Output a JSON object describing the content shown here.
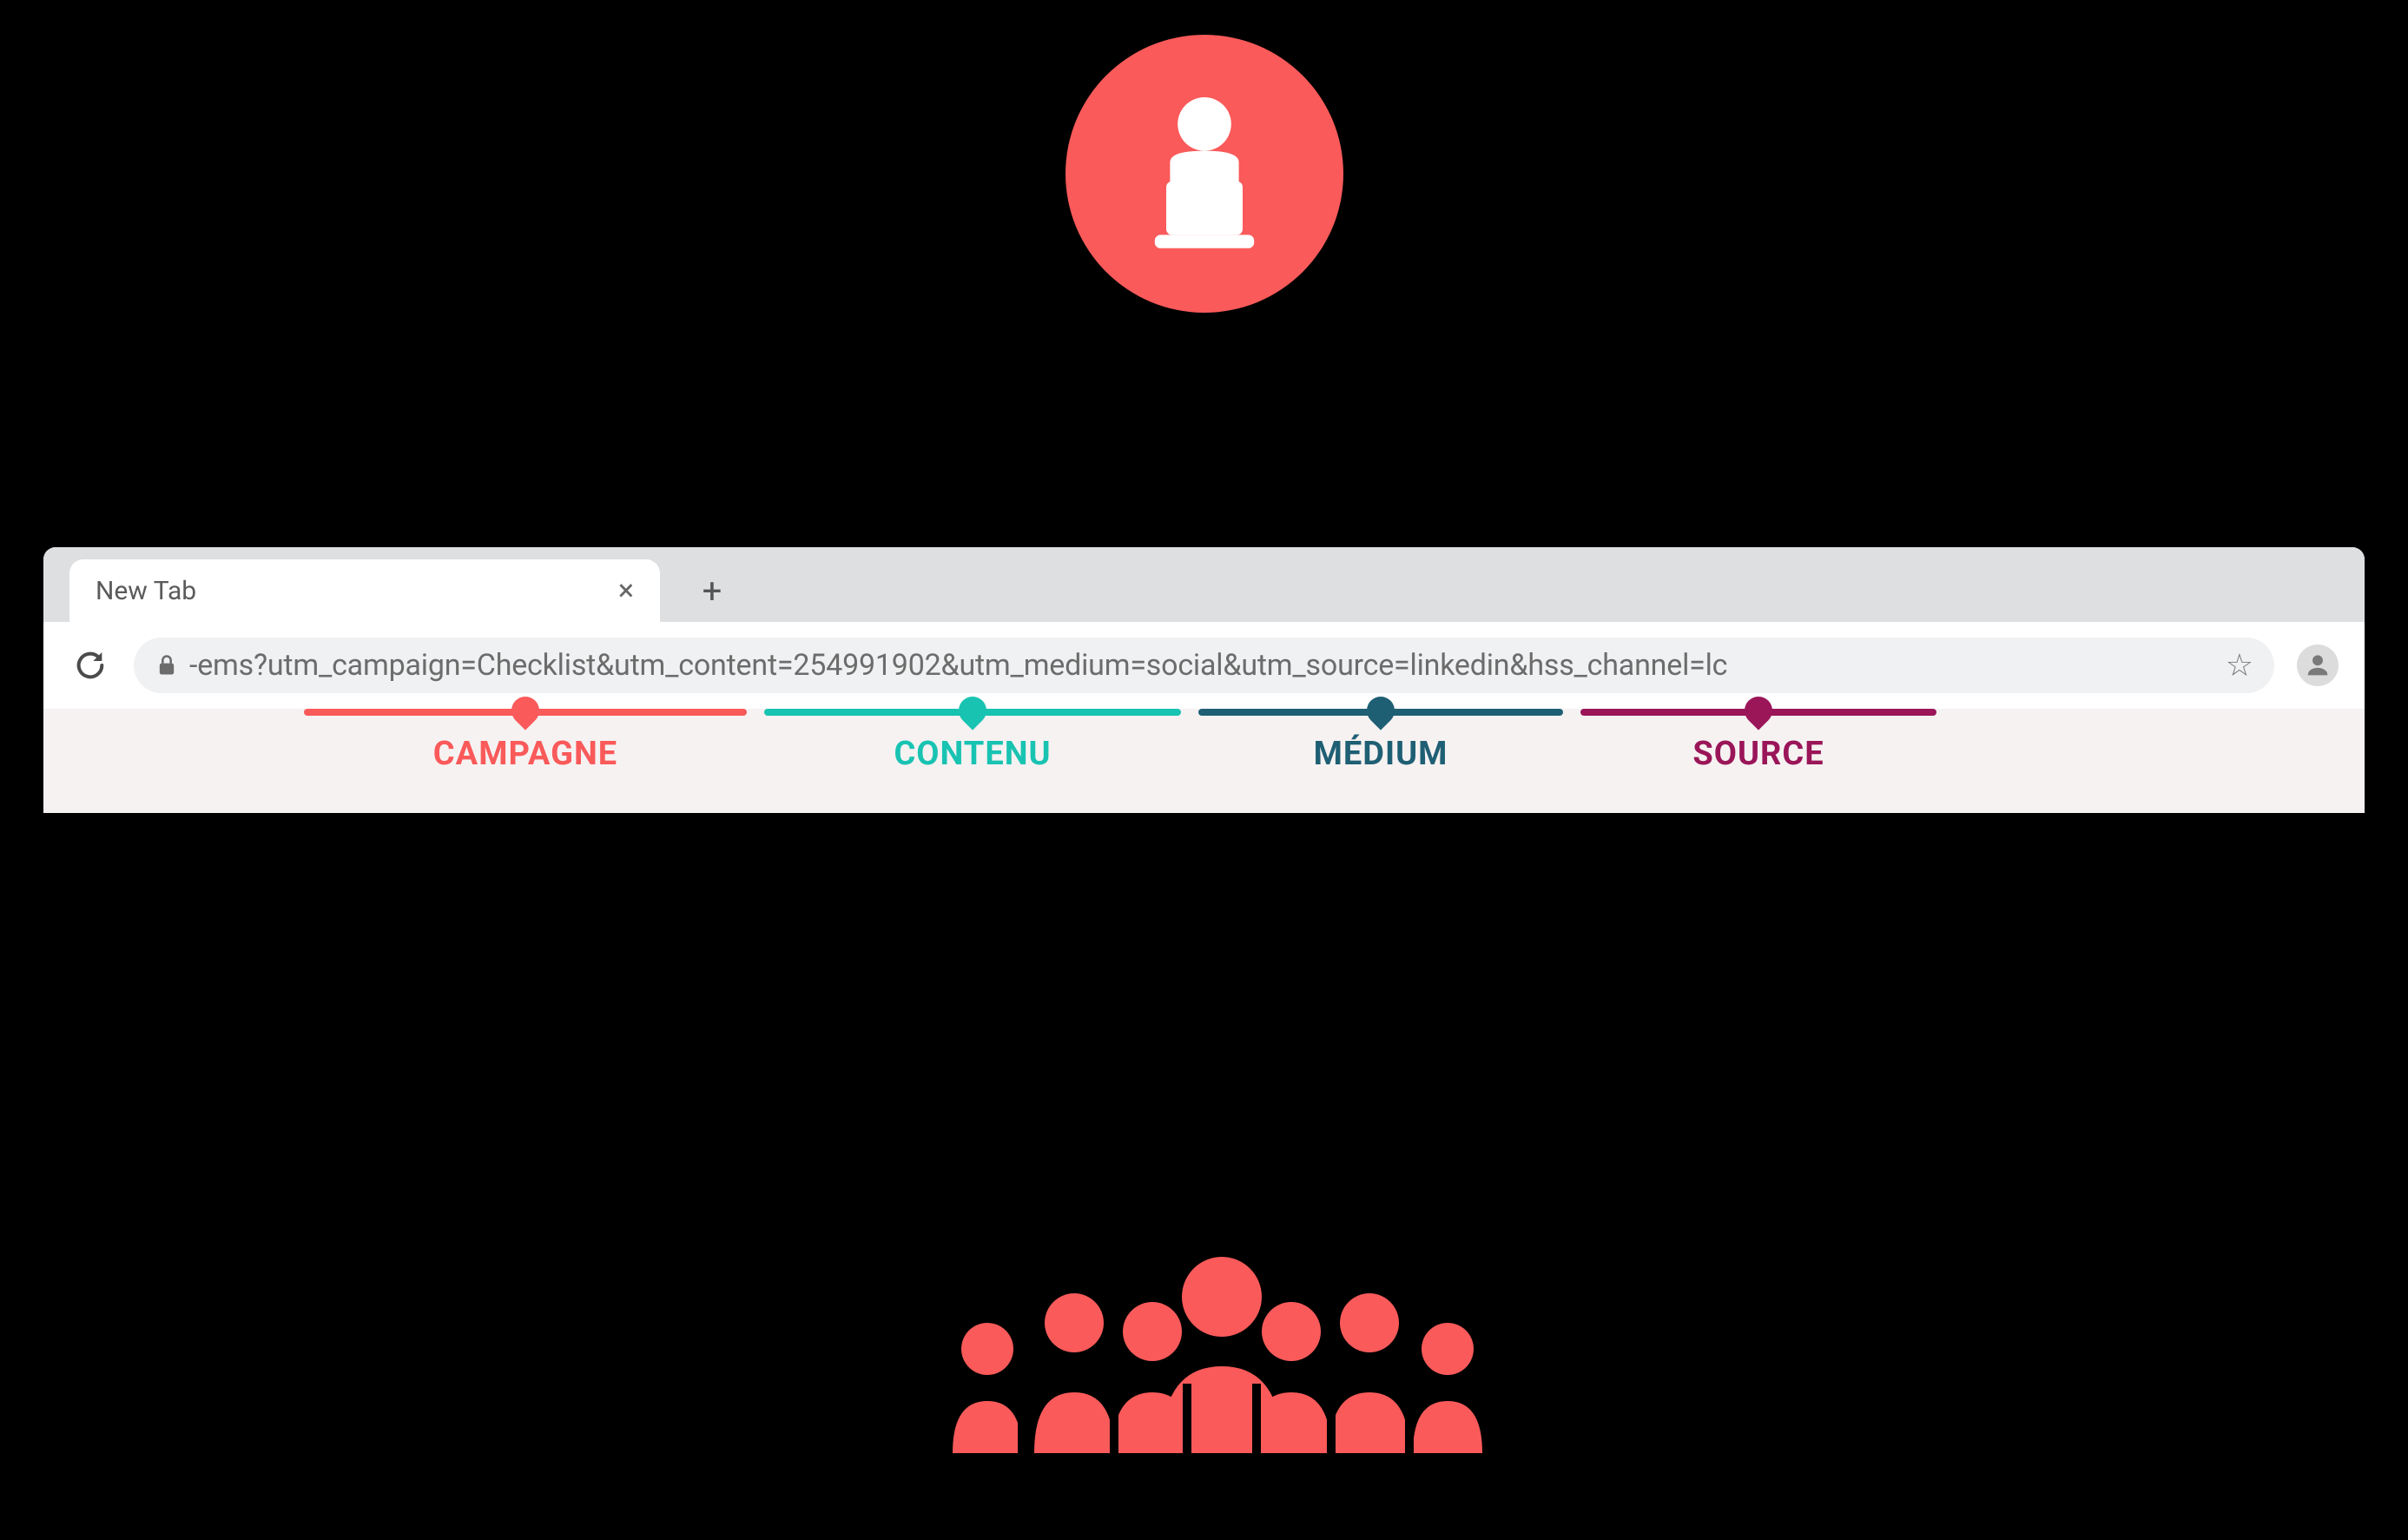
{
  "icons": {
    "marketer": "marketer-laptop-icon",
    "audience": "audience-group-icon"
  },
  "browser": {
    "tab_title": "New Tab",
    "url_display": "-ems?utm_campaign=Checklist&utm_content=254991902&utm_medium=social&utm_source=linkedin&hss_channel=lc"
  },
  "annotations": {
    "campagne": {
      "label": "CAMPAGNE",
      "color": "#fa5a5a"
    },
    "contenu": {
      "label": "CONTENU",
      "color": "#19c3b2"
    },
    "medium": {
      "label": "MÉDIUM",
      "color": "#1f5f74"
    },
    "source": {
      "label": "SOURCE",
      "color": "#9a1659"
    }
  },
  "utm_params": {
    "utm_campaign": "Checklist",
    "utm_content": "254991902",
    "utm_medium": "social",
    "utm_source": "linkedin",
    "hss_channel": "lc"
  }
}
